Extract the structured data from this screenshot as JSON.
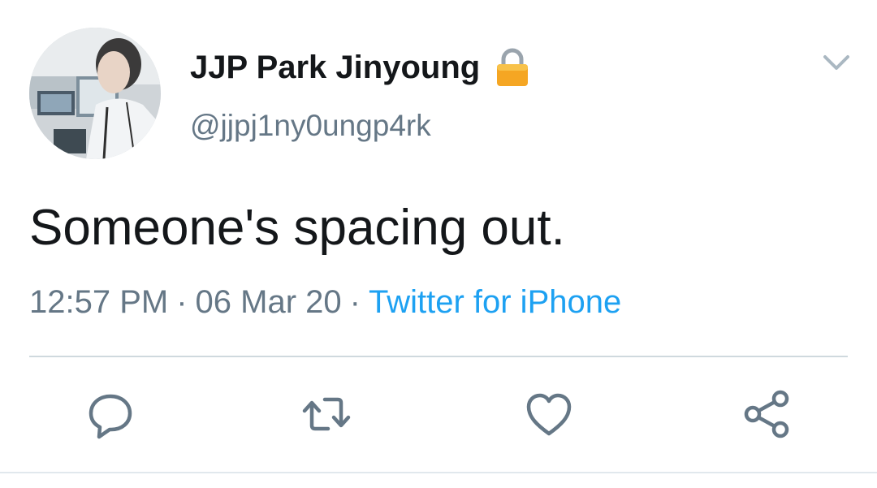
{
  "tweet": {
    "display_name": "JJP Park Jinyoung",
    "handle": "@jjpj1ny0ungp4rk",
    "protected": true,
    "text": "Someone's spacing out.",
    "time": "12:57 PM",
    "date": "06 Mar 20",
    "separator": "·",
    "source": "Twitter for iPhone"
  },
  "icons": {
    "lock": "lock-icon",
    "caret": "chevron-down-icon",
    "reply": "reply-icon",
    "retweet": "retweet-icon",
    "like": "heart-icon",
    "share": "share-icon"
  },
  "colors": {
    "text": "#14171a",
    "secondary": "#657786",
    "link": "#1da1f2",
    "lock": "#f5a623",
    "divider": "#cfd9de"
  }
}
